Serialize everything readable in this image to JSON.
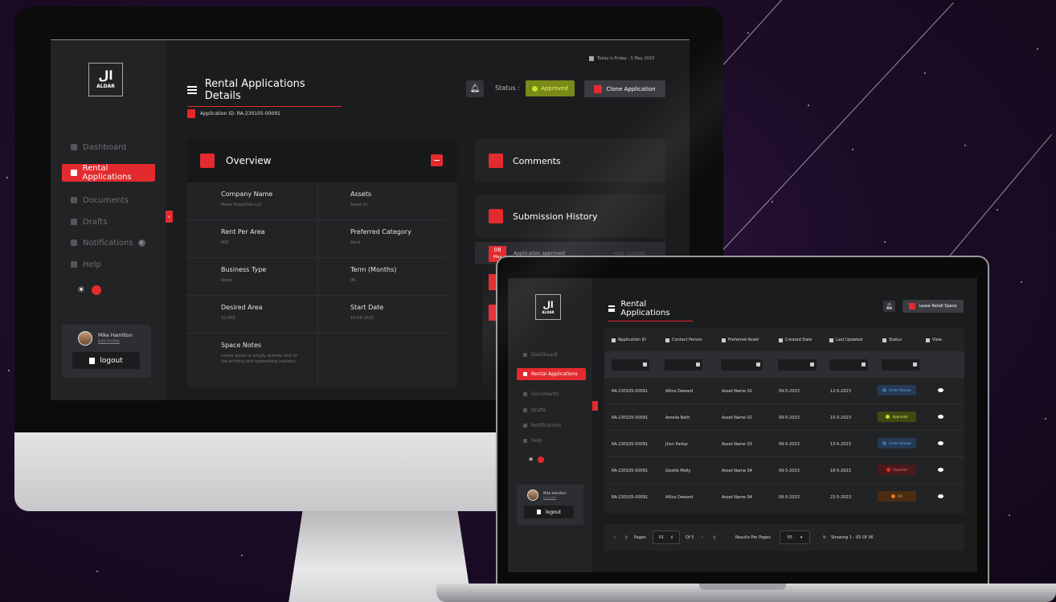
{
  "monitor": {
    "brand": {
      "glyph": "ال",
      "word": "ALDAR"
    },
    "sidebar": {
      "items": [
        {
          "label": "Dashboard"
        },
        {
          "label": "Rental Applications"
        },
        {
          "label": "Documents"
        },
        {
          "label": "Drafts"
        },
        {
          "label": "Notifications"
        },
        {
          "label": "Help"
        }
      ],
      "notifications_badge": "6",
      "profile": {
        "name": "Mike Hamilton",
        "edit": "Edit Profile"
      },
      "logout": "logout"
    },
    "date": "Today is Friday - 5 May 2023",
    "title": "Rental Applications Details",
    "status_label": "Status :",
    "status_value": "Approved",
    "clone_button": "Clone Application",
    "application_id": "Application ID: RA-230105-00091",
    "overview": {
      "title": "Overview",
      "fields": [
        {
          "label": "Company Name",
          "value": "Mena Properties LLC"
        },
        {
          "label": "Assets",
          "value": "Asset 01"
        },
        {
          "label": "Rent Per Area",
          "value": "600"
        },
        {
          "label": "Preferred Category",
          "value": "Abcd"
        },
        {
          "label": "Business Type",
          "value": "Retail"
        },
        {
          "label": "Term (Months)",
          "value": "06"
        },
        {
          "label": "Desired Area",
          "value": "10,000"
        },
        {
          "label": "Start Date",
          "value": "10-08-2023"
        },
        {
          "label": "Space Notes",
          "value": "Lorem Ipsum is simply dummy text of the printing and typesetting industry."
        }
      ]
    },
    "comments_title": "Comments",
    "history": {
      "title": "Submission History",
      "first": {
        "day": "08",
        "month": "May",
        "text": "Application approved",
        "meta": "#0034 · 01/08/2023"
      }
    }
  },
  "laptop": {
    "title": "Rental Applications",
    "lease_button": "Lease Retail Space",
    "columns": [
      "Application ID",
      "Contact Person",
      "Preferred Asset",
      "Created Date",
      "Last Updated",
      "Status",
      "View"
    ],
    "rows": [
      {
        "id": "RA-230105-00091",
        "contact": "Allice Deward",
        "asset": "Asset Name 01",
        "created": "09-5-2023",
        "updated": "12-5-2023",
        "status": "Under Review"
      },
      {
        "id": "RA-230105-00091",
        "contact": "Amelia Beth",
        "asset": "Asset Name 02",
        "created": "09-5-2023",
        "updated": "15-5-2023",
        "status": "Approved"
      },
      {
        "id": "RA-230105-00091",
        "contact": "Jhon Parkar",
        "asset": "Asset Name 03",
        "created": "09-5-2023",
        "updated": "13-5-2023",
        "status": "Under Review"
      },
      {
        "id": "RA-230105-00091",
        "contact": "Giselle Molly",
        "asset": "Asset Name 04",
        "created": "09-5-2023",
        "updated": "18-5-2023",
        "status": "Rejected"
      },
      {
        "id": "RA-230105-00091",
        "contact": "Allice Deward",
        "asset": "Asset Name 04",
        "created": "09-5-2023",
        "updated": "22-5-2023",
        "status": "RFI"
      }
    ],
    "pagination": {
      "pages_label": "Pages",
      "current_page": "01",
      "of_label": "Of 5",
      "results_label": "Results Per Pages",
      "per_page": "05",
      "showing": "Showing 1 - 05 Of 36"
    }
  },
  "colors": {
    "accent": "#e32b2f",
    "approved": "#c5e32a",
    "under_review": "#3a6fb0",
    "rejected": "#e32b2f",
    "rfi": "#e07a1e"
  }
}
